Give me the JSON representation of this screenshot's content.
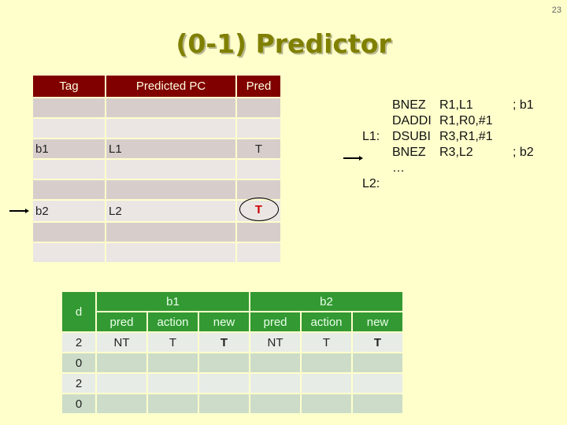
{
  "slide_number": "23",
  "title": "(0-1) Predictor",
  "btb": {
    "headers": [
      "Tag",
      "Predicted PC",
      "Pred"
    ],
    "rows": [
      {
        "tag": "",
        "pc": "",
        "pred": ""
      },
      {
        "tag": "",
        "pc": "",
        "pred": ""
      },
      {
        "tag": "b1",
        "pc": "L1",
        "pred": "T"
      },
      {
        "tag": "",
        "pc": "",
        "pred": ""
      },
      {
        "tag": "",
        "pc": "",
        "pred": ""
      },
      {
        "tag": "b2",
        "pc": "L2",
        "pred": "T"
      },
      {
        "tag": "",
        "pc": "",
        "pred": ""
      },
      {
        "tag": "",
        "pc": "",
        "pred": ""
      }
    ],
    "current_row_arrow": "right-arrow-icon",
    "highlight_color": "#cc0000"
  },
  "code": [
    {
      "label": "",
      "op": "BNEZ",
      "args": "R1,L1",
      "comment": "; b1"
    },
    {
      "label": "",
      "op": "DADDI",
      "args": "R1,R0,#1",
      "comment": ""
    },
    {
      "label": "L1:",
      "op": "DSUBI",
      "args": "R3,R1,#1",
      "comment": ""
    },
    {
      "label": "",
      "op": "BNEZ",
      "args": "R3,L2",
      "comment": "; b2"
    },
    {
      "label": "",
      "op": "…",
      "args": "",
      "comment": ""
    },
    {
      "label": "L2:",
      "op": "",
      "args": "",
      "comment": ""
    }
  ],
  "history": {
    "d_header": "d",
    "groups": [
      "b1",
      "b2"
    ],
    "subheaders": [
      "pred",
      "action",
      "new",
      "pred",
      "action",
      "new"
    ],
    "rows": [
      {
        "d": "2",
        "cells": [
          "NT",
          "T",
          "T",
          "NT",
          "T",
          "T"
        ]
      },
      {
        "d": "0",
        "cells": [
          "",
          "",
          "",
          "",
          "",
          ""
        ]
      },
      {
        "d": "2",
        "cells": [
          "",
          "",
          "",
          "",
          "",
          ""
        ]
      },
      {
        "d": "0",
        "cells": [
          "",
          "",
          "",
          "",
          "",
          ""
        ]
      }
    ]
  },
  "colors": {
    "background": "#ffffcc",
    "title": "#808000",
    "btb_header": "#800000",
    "history_header": "#339933",
    "new_value": "#cc0000"
  }
}
